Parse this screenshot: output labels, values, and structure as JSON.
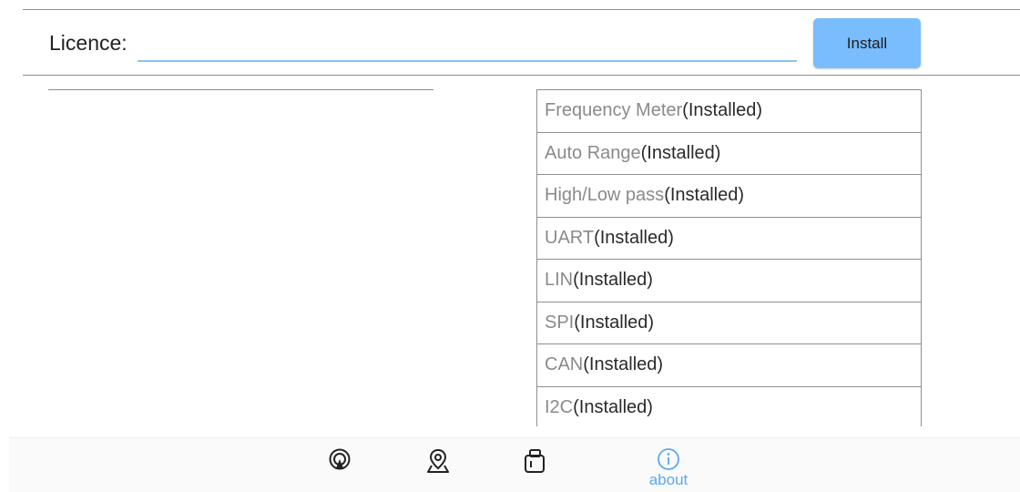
{
  "licence": {
    "label": "Licence:",
    "value": "",
    "install_label": "Install"
  },
  "features": [
    {
      "name": "Frequency Meter",
      "status": "(Installed)"
    },
    {
      "name": "Auto Range",
      "status": "(Installed)"
    },
    {
      "name": "High/Low pass",
      "status": "(Installed)"
    },
    {
      "name": "UART",
      "status": "(Installed)"
    },
    {
      "name": "LIN",
      "status": "(Installed)"
    },
    {
      "name": "SPI",
      "status": "(Installed)"
    },
    {
      "name": "CAN",
      "status": "(Installed)"
    },
    {
      "name": "I2C",
      "status": "(Installed)"
    }
  ],
  "nav": {
    "items": [
      {
        "icon": "signal-icon",
        "label": ""
      },
      {
        "icon": "location-pin-icon",
        "label": ""
      },
      {
        "icon": "probe-icon",
        "label": ""
      },
      {
        "icon": "info-icon",
        "label": "about",
        "active": true
      }
    ]
  },
  "colors": {
    "accent": "#79bdff",
    "active_tab": "#5aa9f0",
    "input_underline": "#86c4ee"
  }
}
